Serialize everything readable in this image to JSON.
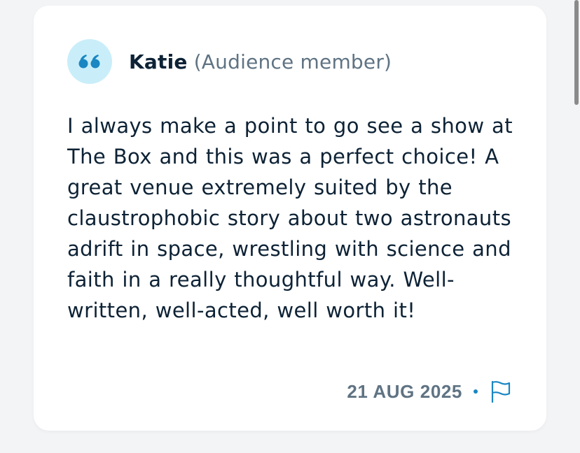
{
  "review": {
    "author_name": "Katie",
    "author_role": "(Audience member)",
    "text": "I always make a point to go see a show at The Box and this was a perfect choice! A great venue extremely suited by the claustrophobic story about two astronauts adrift in space, wrestling with science and faith in a really thoughtful way. Well-written, well-acted, well worth it!",
    "date": "21 AUG 2025"
  },
  "icons": {
    "avatar": "quote-icon",
    "report": "flag-icon"
  },
  "colors": {
    "accent": "#1a86c2",
    "avatar_bg": "#c9eefa",
    "text_primary": "#0d2235",
    "text_secondary": "#5f7383"
  }
}
